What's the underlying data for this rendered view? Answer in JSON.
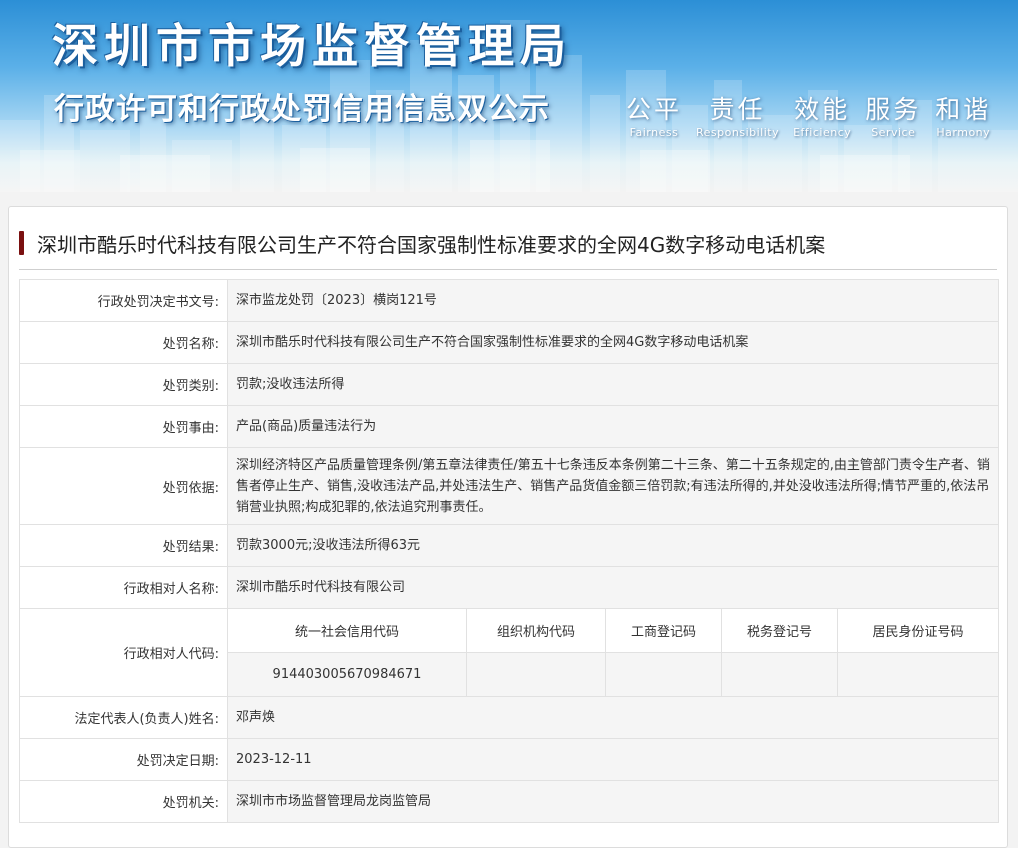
{
  "banner": {
    "title_main": "深圳市市场监督管理局",
    "title_sub": "行政许可和行政处罚信用信息双公示",
    "values": [
      {
        "cn": "公平",
        "en": "Fairness"
      },
      {
        "cn": "责任",
        "en": "Responsibility"
      },
      {
        "cn": "效能",
        "en": "Efficiency"
      },
      {
        "cn": "服务",
        "en": "Service"
      },
      {
        "cn": "和谐",
        "en": "Harmony"
      }
    ]
  },
  "case_title": "深圳市酷乐时代科技有限公司生产不符合国家强制性标准要求的全网4G数字移动电话机案",
  "rows": [
    {
      "label": "行政处罚决定书文号:",
      "value": "深市监龙处罚〔2023〕横岗121号"
    },
    {
      "label": "处罚名称:",
      "value": "深圳市酷乐时代科技有限公司生产不符合国家强制性标准要求的全网4G数字移动电话机案"
    },
    {
      "label": "处罚类别:",
      "value": "罚款;没收违法所得"
    },
    {
      "label": "处罚事由:",
      "value": "产品(商品)质量违法行为"
    },
    {
      "label": "处罚依据:",
      "value": "深圳经济特区产品质量管理条例/第五章法律责任/第五十七条违反本条例第二十三条、第二十五条规定的,由主管部门责令生产者、销售者停止生产、销售,没收违法产品,并处违法生产、销售产品货值金额三倍罚款;有违法所得的,并处没收违法所得;情节严重的,依法吊销营业执照;构成犯罪的,依法追究刑事责任。"
    },
    {
      "label": "处罚结果:",
      "value": "罚款3000元;没收违法所得63元"
    },
    {
      "label": "行政相对人名称:",
      "value": "深圳市酷乐时代科技有限公司"
    },
    {
      "label": "法定代表人(负责人)姓名:",
      "value": "邓声焕"
    },
    {
      "label": "处罚决定日期:",
      "value": "2023-12-11"
    },
    {
      "label": "处罚机关:",
      "value": "深圳市市场监督管理局龙岗监管局"
    }
  ],
  "codes": {
    "label": "行政相对人代码:",
    "headers": [
      "统一社会信用代码",
      "组织机构代码",
      "工商登记码",
      "税务登记号",
      "居民身份证号码"
    ],
    "values": [
      "914403005670984671",
      "",
      "",
      "",
      ""
    ]
  },
  "colors": {
    "accent_bar": "#7a1010",
    "banner_blue": "#2c8fd6"
  }
}
